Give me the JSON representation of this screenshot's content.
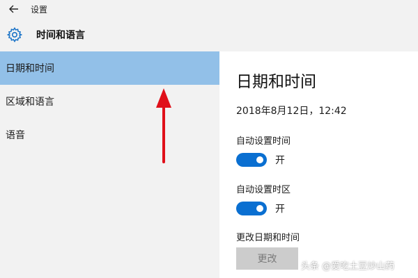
{
  "window": {
    "title": "设置"
  },
  "header": {
    "title": "时间和语言"
  },
  "sidebar": {
    "items": [
      {
        "label": "日期和时间"
      },
      {
        "label": "区域和语言"
      },
      {
        "label": "语音"
      }
    ],
    "selected_index": 0
  },
  "content": {
    "title": "日期和时间",
    "datetime": "2018年8月12日，12:42",
    "auto_time_label": "自动设置时间",
    "auto_time_state": "开",
    "auto_timezone_label": "自动设置时区",
    "auto_timezone_state": "开",
    "change_label": "更改日期和时间",
    "change_button": "更改"
  },
  "watermark": "头条 @爱吃土豆炒山药",
  "colors": {
    "accent": "#0a6fd1",
    "selected_bg": "#92c0e8",
    "annotation_arrow": "#e0101a"
  },
  "icons": {
    "back": "back-arrow-icon",
    "settings": "gear-icon"
  }
}
